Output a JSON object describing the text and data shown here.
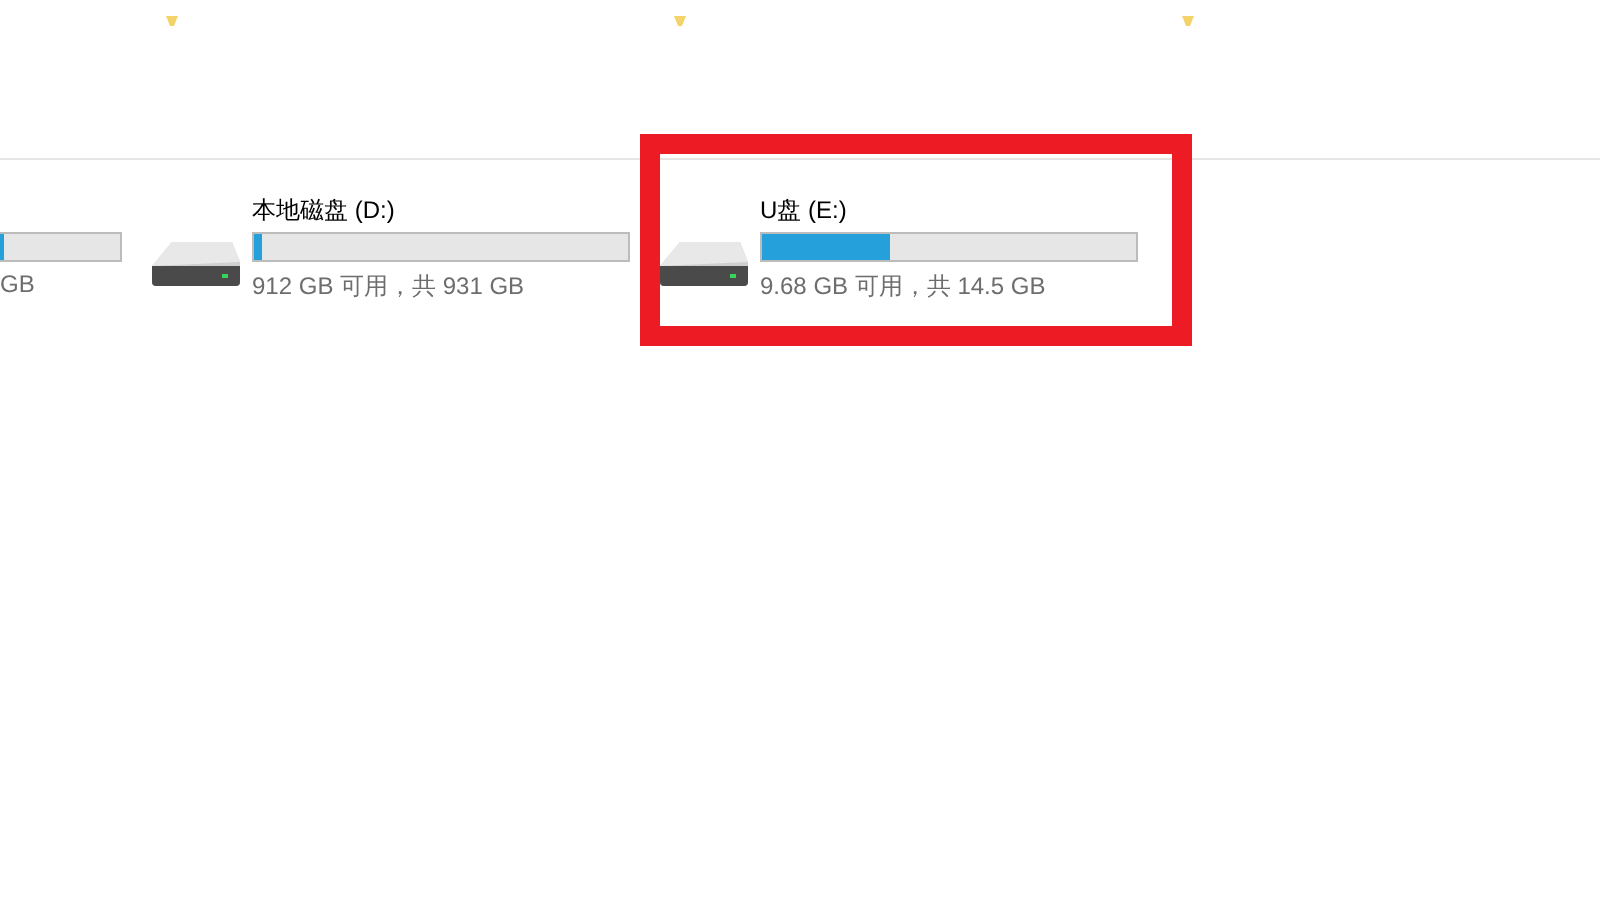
{
  "folders_above": [
    {
      "kind": "folder"
    },
    {
      "kind": "folder"
    },
    {
      "kind": "folder"
    }
  ],
  "drives": [
    {
      "kind": "cut",
      "free_text": "GB",
      "level": 0.69
    },
    {
      "name": "本地磁盘 (D:)",
      "free_text": "912 GB 可用，共 931 GB",
      "level": 0.02,
      "highlighted": false
    },
    {
      "name": "U盘 (E:)",
      "free_text": "9.68 GB 可用，共 14.5 GB",
      "level": 0.34,
      "highlighted": true
    }
  ]
}
